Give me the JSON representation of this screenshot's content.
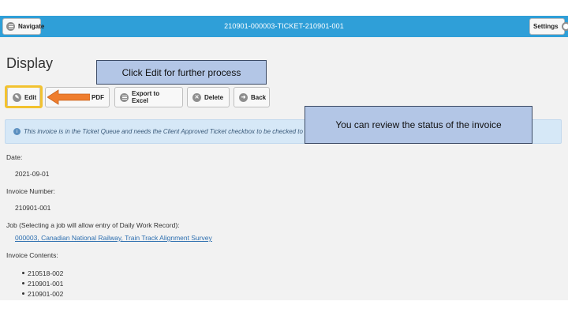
{
  "header": {
    "navigate_label": "Navigate",
    "title": "210901-000003-TICKET-210901-001",
    "settings_label": "Settings",
    "bar_color": "#2f9fd8"
  },
  "page": {
    "title": "Display"
  },
  "toolbar": {
    "edit_label": "Edit",
    "pdf_label": "PDF",
    "export_label": "Export to Excel",
    "delete_label": "Delete",
    "back_label": "Back"
  },
  "callouts": {
    "edit_hint": "Click Edit for further process",
    "status_hint": "You can review the status of the invoice"
  },
  "alert": {
    "message": "This invoice is in the Ticket Queue and needs the Client Approved Ticket checkbox to be checked to proceed."
  },
  "details": {
    "date_label": "Date:",
    "date_value": "2021-09-01",
    "invoice_number_label": "Invoice Number:",
    "invoice_number_value": "210901-001",
    "job_label": "Job (Selecting a job will allow entry of Daily Work Record):",
    "job_value": "000003, Canadian National Railway, Train Track Alignment Survey",
    "contents_label": "Invoice Contents:",
    "contents": [
      "210518-002",
      "210901-001",
      "210901-002"
    ]
  },
  "icons": {
    "navigate": "menu-icon",
    "settings": "gear-icon",
    "edit": "pencil-icon",
    "export": "list-icon",
    "delete": "x-circle-icon",
    "back": "back-arrow-icon",
    "alert": "info-icon",
    "pointer": "orange-arrow-icon"
  },
  "colors": {
    "highlight": "#f2c230",
    "arrow": "#ef7d2d",
    "callout_bg": "#b3c6e6",
    "alert_bg": "#d6e8f7",
    "link": "#2d6fb0"
  }
}
